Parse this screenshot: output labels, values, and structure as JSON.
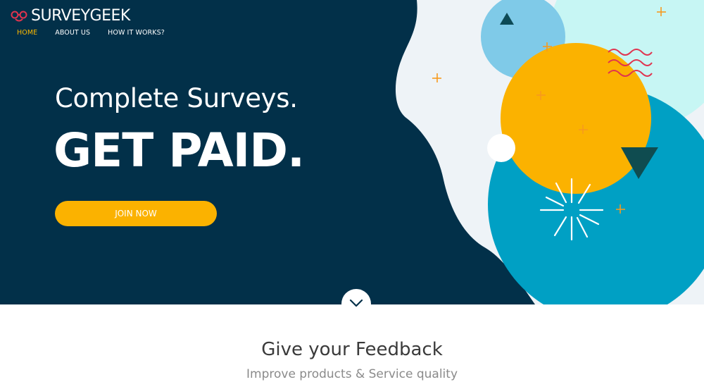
{
  "brand": {
    "name": "SURVEYGEEK",
    "logo_icon": "glasses-smile-icon",
    "colors": {
      "navy": "#023049",
      "accent_yellow": "#fbb200",
      "nav_active": "#fbb900",
      "light_blue": "#7fcae8",
      "teal": "#00a0c4",
      "mint": "#c7f6f4",
      "pale": "#eef3f7",
      "orange_plus": "#f79a1e",
      "wave_red": "#e0344f",
      "dark_triangle": "#0f4c50"
    }
  },
  "nav": {
    "items": [
      {
        "label": "HOME",
        "active": true
      },
      {
        "label": "ABOUT US",
        "active": false
      },
      {
        "label": "HOW IT WORKS?",
        "active": false
      }
    ]
  },
  "hero": {
    "headline_1": "Complete Surveys.",
    "headline_2": "GET PAID.",
    "cta_label": "JOIN NOW",
    "scroll_icon": "chevron-down-icon"
  },
  "feedback": {
    "title": "Give your Feedback",
    "subtitle": "Improve products & Service quality"
  }
}
